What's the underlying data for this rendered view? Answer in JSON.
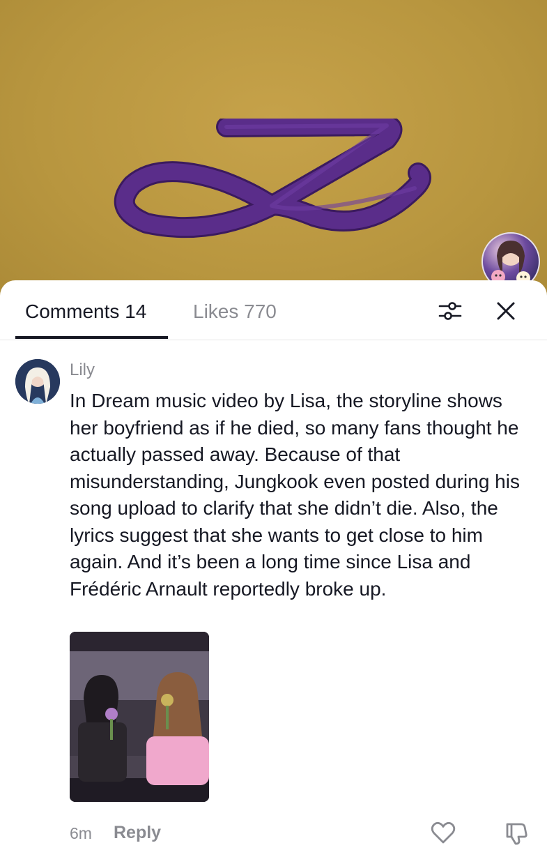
{
  "tabs": {
    "comments_label": "Comments 14",
    "likes_label": "Likes 770",
    "active": "comments"
  },
  "icons": {
    "filter": "sliders-icon",
    "close": "close-icon",
    "like": "heart-outline-icon",
    "dislike": "thumbs-down-icon"
  },
  "comment": {
    "username": "Lily",
    "text": "In Dream music video by Lisa, the storyline shows her boyfriend as if he died, so many fans thought he actually passed away. Because of that misunderstanding, Jungkook even posted during his song upload to clarify that she didn’t die. Also, the lyrics suggest that she wants to get close to him again. And it’s been a long time since Lisa and Frédéric Arnault reportedly broke up.",
    "time": "6m",
    "reply_label": "Reply"
  },
  "colors": {
    "background_gold": "#b8963f",
    "logo_purple": "#5a2d8a",
    "text_primary": "#161823",
    "text_secondary": "#8a8b91"
  }
}
